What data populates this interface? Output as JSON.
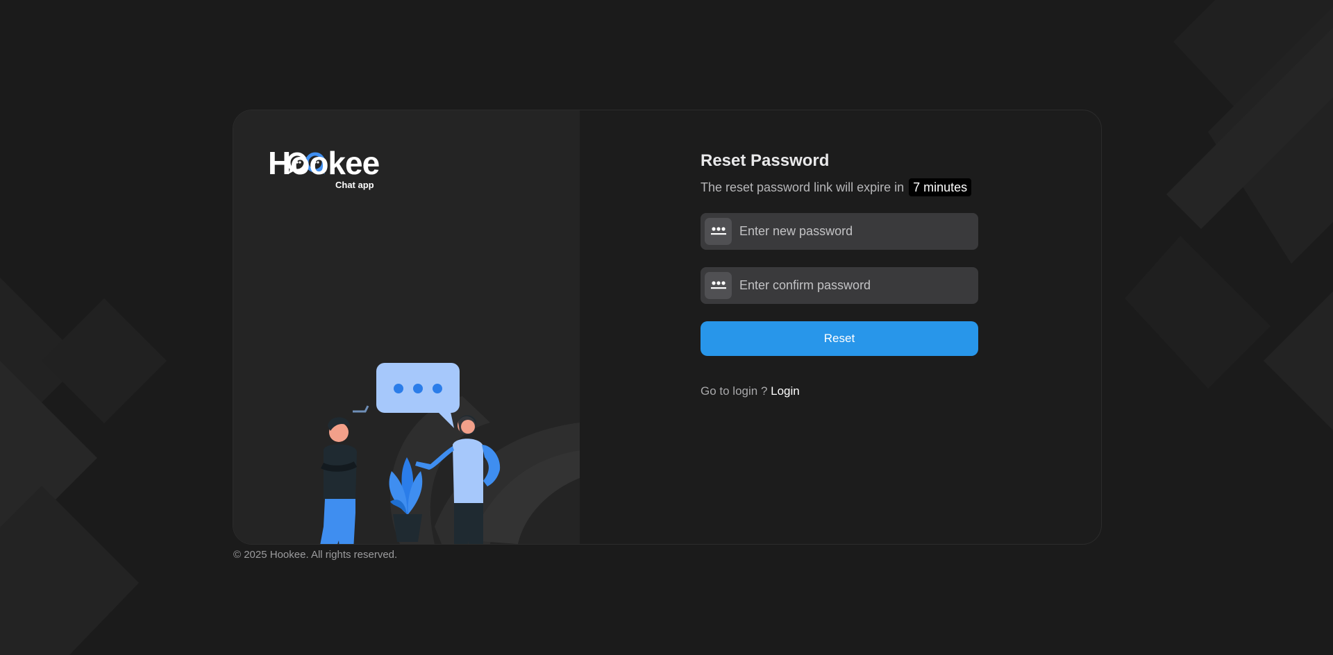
{
  "brand": {
    "name": "Hookee",
    "tagline": "Chat app"
  },
  "reset": {
    "title": "Reset Password",
    "subtitle": "The reset password link will expire in",
    "timer": "7 minutes",
    "new_password_placeholder": "Enter new password",
    "confirm_password_placeholder": "Enter confirm password",
    "button_label": "Reset",
    "login_prompt": "Go to login ?",
    "login_link": "Login"
  },
  "footer": {
    "copyright": "© 2025 Hookee. All rights reserved."
  },
  "icons": {
    "field_icon": "password-dots-icon",
    "illustration": "two-people-chatting-illustration"
  },
  "colors": {
    "background": "#1b1b1b",
    "panel": "#242424",
    "field": "#3a3a3c",
    "accent": "#2896ea",
    "illustration_blue": "#3f8ef0"
  }
}
